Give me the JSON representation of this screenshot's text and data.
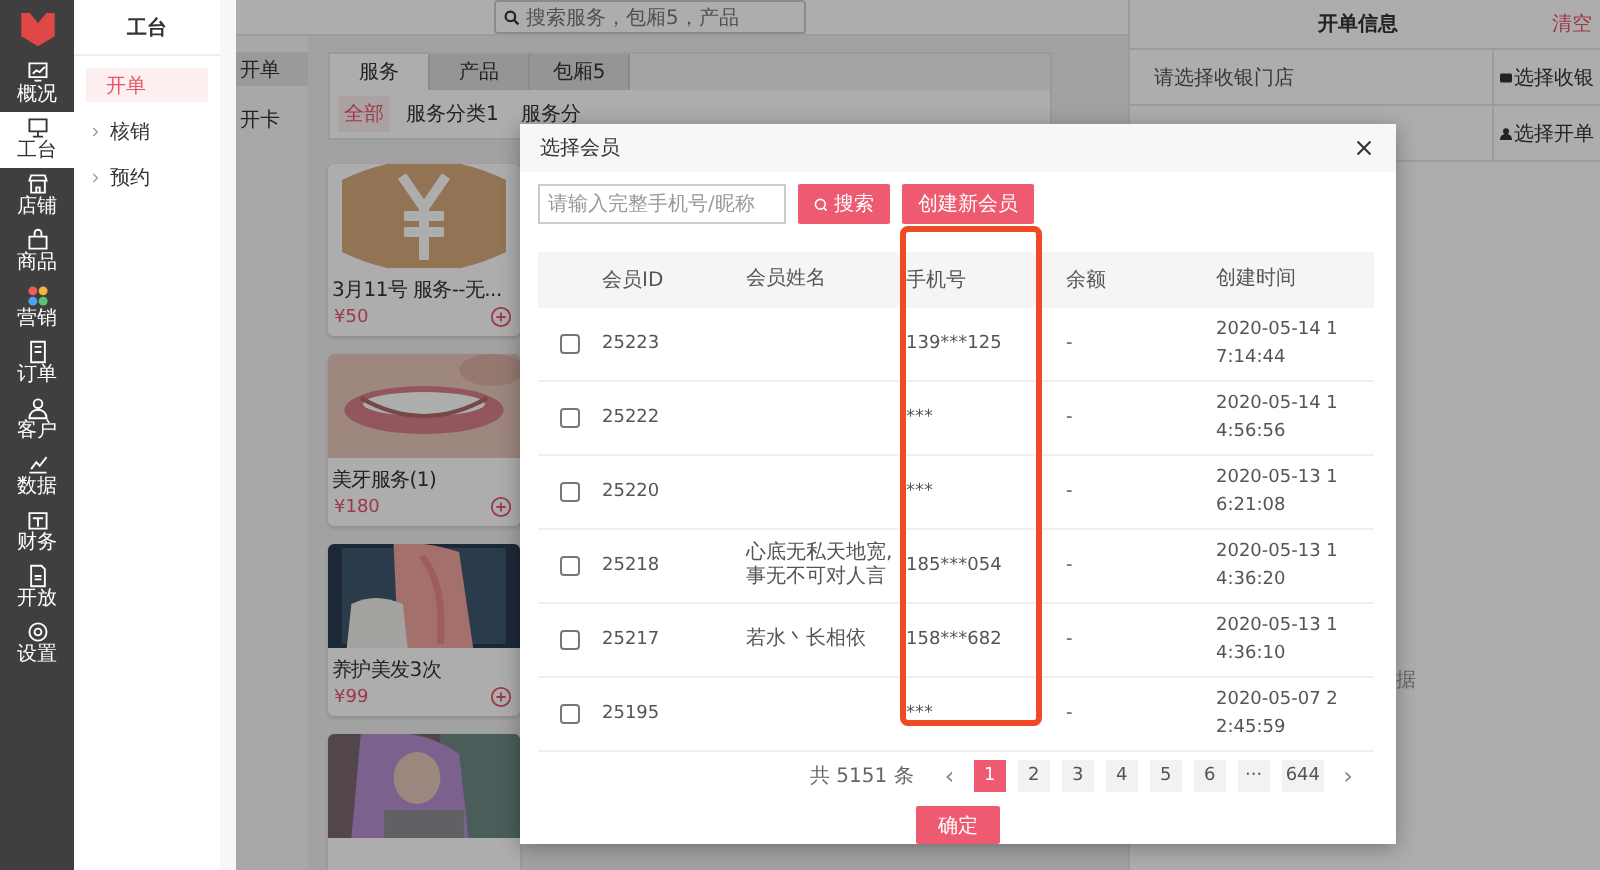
{
  "nav": {
    "items": [
      {
        "label": "概况",
        "selected": false
      },
      {
        "label": "工台",
        "selected": true
      },
      {
        "label": "店铺",
        "selected": false
      },
      {
        "label": "商品",
        "selected": false
      },
      {
        "label": "营销",
        "selected": false
      },
      {
        "label": "订单",
        "selected": false
      },
      {
        "label": "客户",
        "selected": false
      },
      {
        "label": "数据",
        "selected": false
      },
      {
        "label": "财务",
        "selected": false
      },
      {
        "label": "开放",
        "selected": false
      },
      {
        "label": "设置",
        "selected": false
      }
    ]
  },
  "submenu": {
    "title": "工台",
    "items": [
      {
        "label": "开单",
        "selected": true,
        "expandable": false
      },
      {
        "label": "核销",
        "selected": false,
        "expandable": true
      },
      {
        "label": "预约",
        "selected": false,
        "expandable": true
      }
    ]
  },
  "search": {
    "placeholder": "搜索服务，包厢5，产品"
  },
  "side_list": [
    {
      "label": "开单",
      "selected": true
    },
    {
      "label": "开卡",
      "selected": false
    }
  ],
  "tabs": [
    {
      "label": "服务",
      "selected": true
    },
    {
      "label": "产品",
      "selected": false
    },
    {
      "label": "包厢5",
      "selected": false
    }
  ],
  "categories": [
    {
      "label": "全部",
      "selected": true
    },
    {
      "label": "服务分类1",
      "selected": false
    },
    {
      "label": "服务分",
      "selected": false
    }
  ],
  "products": [
    {
      "kind": "placeholder",
      "name": "3月11号 服务--无...",
      "price": "¥50"
    },
    {
      "kind": "picture",
      "name": "美牙服务(1)",
      "price": "¥180"
    },
    {
      "kind": "picture",
      "name": "养护美发3次",
      "price": "¥99"
    },
    {
      "kind": "picture"
    }
  ],
  "order_panel": {
    "title": "开单信息",
    "clear": "清空",
    "store_hint": "请选择收银门店",
    "store_button": "选择收银",
    "member_button": "选择开单",
    "empty_text": "据"
  },
  "dialog": {
    "title": "选择会员",
    "search": {
      "placeholder": "请输入完整手机号/昵称"
    },
    "search_button": "搜索",
    "create_button": "创建新会员",
    "table": {
      "columns": [
        "会员ID",
        "会员姓名",
        "手机号",
        "余额",
        "创建时间"
      ],
      "rows": [
        {
          "checked": false,
          "cells": [
            "25223",
            "",
            "139***125",
            "-",
            "2020-05-14 17:14:44"
          ]
        },
        {
          "checked": false,
          "cells": [
            "25222",
            "",
            "***",
            "-",
            "2020-05-14 14:56:56"
          ]
        },
        {
          "checked": false,
          "cells": [
            "25220",
            "",
            "***",
            "-",
            "2020-05-13 16:21:08"
          ]
        },
        {
          "checked": false,
          "cells": [
            "25218",
            "心底无私天地宽,事无不可对人言",
            "185***054",
            "-",
            "2020-05-13 14:36:20"
          ]
        },
        {
          "checked": false,
          "cells": [
            "25217",
            "若水丶长相依",
            "158***682",
            "-",
            "2020-05-13 14:36:10"
          ]
        },
        {
          "checked": false,
          "cells": [
            "25195",
            "",
            "***",
            "-",
            "2020-05-07 22:45:59"
          ]
        }
      ]
    },
    "highlight": true,
    "pagination": {
      "total": "共 5151 条",
      "prev": "‹",
      "next": "›",
      "pages": [
        {
          "label": "1",
          "selected": true
        },
        {
          "label": "2",
          "selected": false
        },
        {
          "label": "3",
          "selected": false
        },
        {
          "label": "4",
          "selected": false
        },
        {
          "label": "5",
          "selected": false
        },
        {
          "label": "6",
          "selected": false
        },
        {
          "label": "···",
          "selected": false
        },
        {
          "label": "644",
          "selected": false
        }
      ]
    },
    "confirm_button": "确定"
  }
}
